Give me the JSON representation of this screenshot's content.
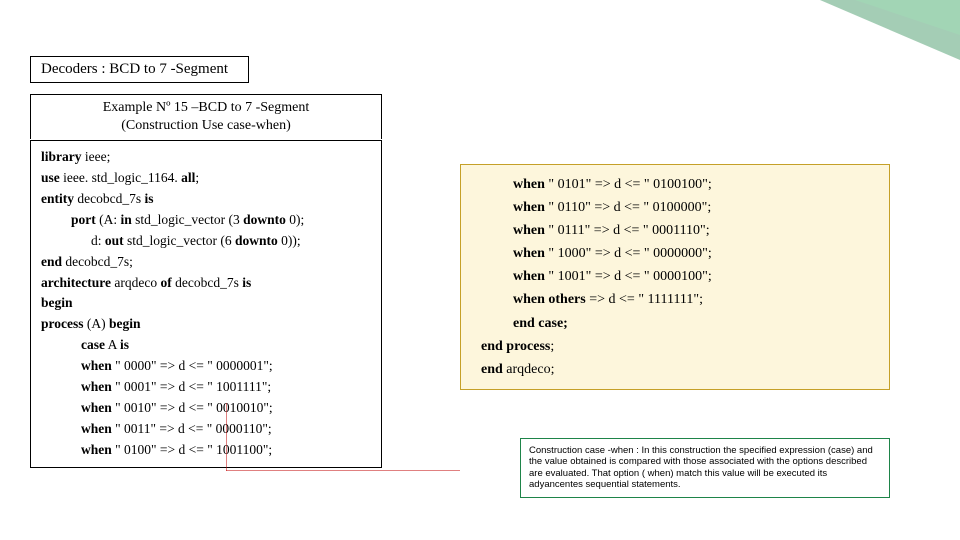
{
  "title": "Decoders : BCD to 7 -Segment",
  "example": {
    "line1": "Example Nº 15 –BCD to 7 -Segment",
    "line2": "(Construction Use case-when)"
  },
  "codeLeft": {
    "l1a": "library",
    "l1b": " ieee;",
    "l2a": "use",
    "l2b": " ieee. std_logic_1164. ",
    "l2c": "all",
    "l2d": ";",
    "l3a": "entity",
    "l3b": " decobcd_7s ",
    "l3c": "is",
    "l4a": "port",
    "l4b": " (A: ",
    "l4c": "in",
    "l4d": " std_logic_vector (3 ",
    "l4e": "downto",
    "l4f": " 0);",
    "l5a": "d: ",
    "l5b": "out",
    "l5c": " std_logic_vector (6 ",
    "l5d": "downto",
    "l5e": " 0));",
    "l6a": "end",
    "l6b": " decobcd_7s;",
    "l7a": "architecture",
    "l7b": " arqdeco ",
    "l7c": "of",
    "l7d": " decobcd_7s ",
    "l7e": "is",
    "l8": "begin",
    "l9a": "process",
    "l9b": " (A) ",
    "l9c": "begin",
    "l10a": "case",
    "l10b": " A ",
    "l10c": "is",
    "l11a": "when",
    "l11b": " \" 0000\" => d <= \" 0000001\";",
    "l12a": "when",
    "l12b": " \" 0001\" => d <= \" 1001111\";",
    "l13a": "when",
    "l13b": " \" 0010\" => d <= \" 0010010\";",
    "l14a": "when",
    "l14b": " \" 0011\" => d <= \" 0000110\";",
    "l15a": "when",
    "l15b": " \" 0100\" => d <= \" 1001100\";"
  },
  "codeRight": {
    "r1a": "when",
    "r1b": " \" 0101\" => d <= \" 0100100\";",
    "r2a": "when",
    "r2b": " \" 0110\" => d <= \" 0100000\";",
    "r3a": "when",
    "r3b": " \" 0111\" => d <= \" 0001110\";",
    "r4a": "when",
    "r4b": " \" 1000\" => d <= \" 0000000\";",
    "r5a": "when",
    "r5b": " \" 1001\" => d <= \" 0000100\";",
    "r6a": "when others",
    "r6b": " => d <= \" 1111111\";",
    "r7": "end case;",
    "r8a": "end process",
    "r8b": ";",
    "r9a": "end",
    "r9b": " arqdeco;"
  },
  "note": "Construction case -when : In this construction the specified expression (case) and the value obtained is compared with those associated with the options described are evaluated. That option ( when) match this value will be executed its adyancentes sequential statements."
}
